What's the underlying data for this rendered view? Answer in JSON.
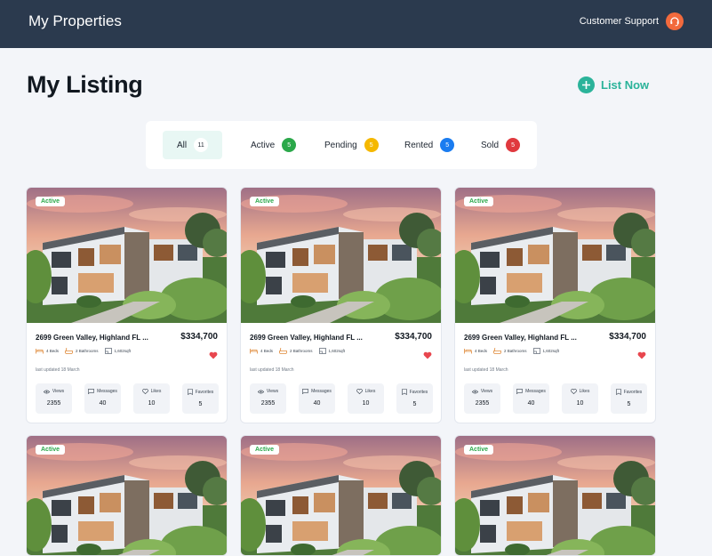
{
  "header": {
    "title": "My Properties",
    "support_label": "Customer Support"
  },
  "page": {
    "title": "My Listing",
    "list_now_label": "List Now"
  },
  "filters": [
    {
      "label": "All",
      "count": "11",
      "color": "#ffffff"
    },
    {
      "label": "Active",
      "count": "5",
      "color": "#2ba84a"
    },
    {
      "label": "Pending",
      "count": "5",
      "color": "#f5b800"
    },
    {
      "label": "Rented",
      "count": "5",
      "color": "#1a7cf0"
    },
    {
      "label": "Sold",
      "count": "5",
      "color": "#e0393e"
    }
  ],
  "listing_template": {
    "status": "Active",
    "address": "2699 Green Valley, Highland FL ...",
    "price": "$334,700",
    "beds": "4 Beds",
    "baths": "2 Bathrooms",
    "area": "1,602sqft",
    "updated": "last updated 18 March",
    "stats": [
      {
        "label": "Views",
        "value": "2355",
        "icon": "eye-icon"
      },
      {
        "label": "Messages",
        "value": "40",
        "icon": "message-icon"
      },
      {
        "label": "Likes",
        "value": "10",
        "icon": "heart-outline-icon"
      },
      {
        "label": "Favorites",
        "value": "5",
        "icon": "bookmark-icon"
      }
    ]
  },
  "listings": [
    {
      "status": "Active",
      "address": "2699 Green Valley, Highland FL ...",
      "price": "$334,700",
      "beds": "4 Beds",
      "baths": "2 Bathrooms",
      "area": "1,602sqft",
      "updated": "last updated 18 March",
      "views": "2355",
      "messages": "40",
      "likes": "10",
      "favorites": "5"
    },
    {
      "status": "Active",
      "address": "2699 Green Valley, Highland FL ...",
      "price": "$334,700",
      "beds": "4 Beds",
      "baths": "2 Bathrooms",
      "area": "1,602sqft",
      "updated": "last updated 18 March",
      "views": "2355",
      "messages": "40",
      "likes": "10",
      "favorites": "5"
    },
    {
      "status": "Active",
      "address": "2699 Green Valley, Highland FL ...",
      "price": "$334,700",
      "beds": "4 Beds",
      "baths": "2 Bathrooms",
      "area": "1,602sqft",
      "updated": "last updated 18 March",
      "views": "2355",
      "messages": "40",
      "likes": "10",
      "favorites": "5"
    },
    {
      "status": "Active"
    },
    {
      "status": "Active"
    },
    {
      "status": "Active"
    }
  ],
  "stat_labels": {
    "views": "Views",
    "messages": "Messages",
    "likes": "Likes",
    "favorites": "Favorites"
  },
  "colors": {
    "header_bg": "#2b3a4e",
    "accent": "#2bb39a",
    "support_icon": "#f26a3d",
    "active": "#2ba84a",
    "heart": "#e8464e"
  }
}
